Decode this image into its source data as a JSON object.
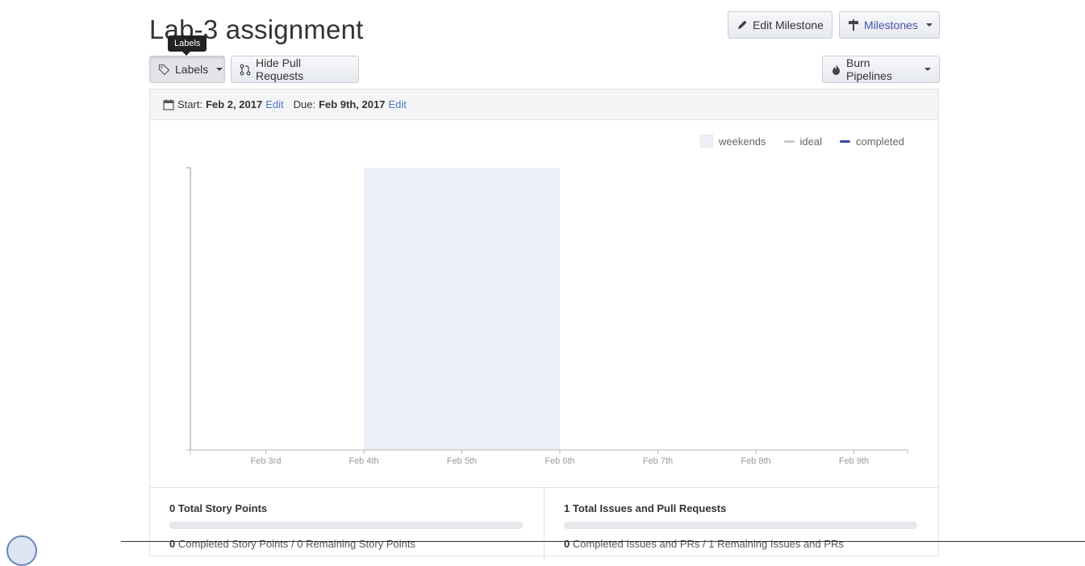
{
  "header": {
    "title": "Lab-3 assignment",
    "tooltip": "Labels",
    "edit_milestone": "Edit Milestone",
    "milestones": "Milestones",
    "labels": "Labels",
    "hide_pull_requests": "Hide Pull Requests",
    "burn_pipelines": "Burn Pipelines"
  },
  "dates": {
    "start_label": "Start:",
    "start_value": "Feb 2, 2017",
    "due_label": "Due:",
    "due_value": "Feb 9th, 2017",
    "edit": "Edit"
  },
  "legend": {
    "weekends": "weekends",
    "ideal": "ideal",
    "completed": "completed"
  },
  "chart_data": {
    "type": "line",
    "x": [
      "Feb 3rd",
      "Feb 4th",
      "Feb 5th",
      "Feb 6th",
      "Feb 7th",
      "Feb 8th",
      "Feb 9th"
    ],
    "weekend_range": [
      "Feb 4th",
      "Feb 6th"
    ],
    "series": [
      {
        "name": "ideal",
        "values": []
      },
      {
        "name": "completed",
        "values": []
      }
    ],
    "legend_position": "top-right",
    "colors": {
      "weekends": "#eef0f8",
      "ideal": "#c7c9cc",
      "completed": "#3b4a9a"
    }
  },
  "stats": {
    "story_points": {
      "total_count": "0",
      "total_label": "Total Story Points",
      "completed_count": "0",
      "completed_label": "Completed Story Points",
      "remaining_text": "/ 0 Remaining Story Points",
      "progress": 0
    },
    "issues": {
      "total_count": "1",
      "total_label": "Total Issues and Pull Requests",
      "completed_count": "0",
      "completed_label": "Completed Issues and PRs",
      "remaining_text": "/ 1 Remaining Issues and PRs",
      "progress": 0
    }
  },
  "colors": {
    "accent": "#4a54a8",
    "link": "#4a78c2"
  }
}
